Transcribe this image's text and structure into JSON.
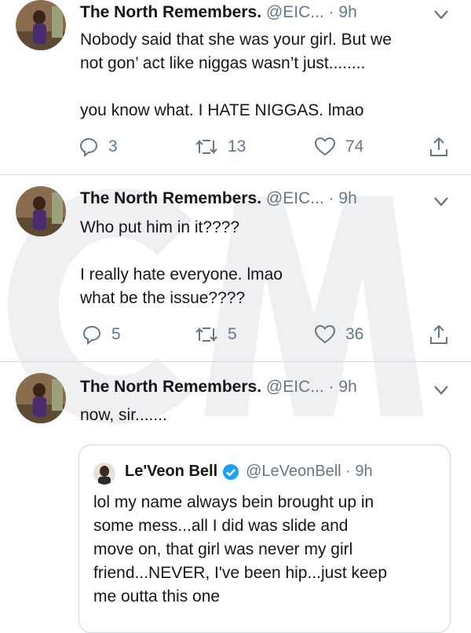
{
  "tweets": [
    {
      "name": "The North Remembers.",
      "handle_time": "@EIC... · 9h",
      "lines": [
        "Nobody said that she was your girl. But we",
        "not gon’ act like niggas wasn’t just........",
        "",
        "you know what. I HATE NIGGAS. lmao"
      ],
      "replies": "3",
      "retweets": "13",
      "likes": "74"
    },
    {
      "name": "The North Remembers.",
      "handle_time": "@EIC... · 9h",
      "lines": [
        "Who put him in it????",
        "",
        "I really hate everyone. lmao",
        "what be the issue????"
      ],
      "replies": "5",
      "retweets": "5",
      "likes": "36"
    },
    {
      "name": "The North Remembers.",
      "handle_time": "@EIC... · 9h",
      "lines": [
        "now, sir......."
      ]
    }
  ],
  "quote": {
    "name": "Le'Veon Bell",
    "handle_time": "@LeVeonBell · 9h",
    "lines": [
      "lol my name always bein brought up in",
      "some mess...all I did was slide and",
      "move on, that girl was never my girl",
      "friend...NEVER, I've been hip...just keep",
      "me outta this one"
    ]
  },
  "colors": {
    "text": "#14171a",
    "secondary": "#657786",
    "verified": "#1da1f2",
    "divider": "#d5dbe0"
  },
  "icons": [
    "reply-icon",
    "retweet-icon",
    "like-icon",
    "share-icon",
    "chevron-down-icon",
    "verified-badge-icon"
  ]
}
